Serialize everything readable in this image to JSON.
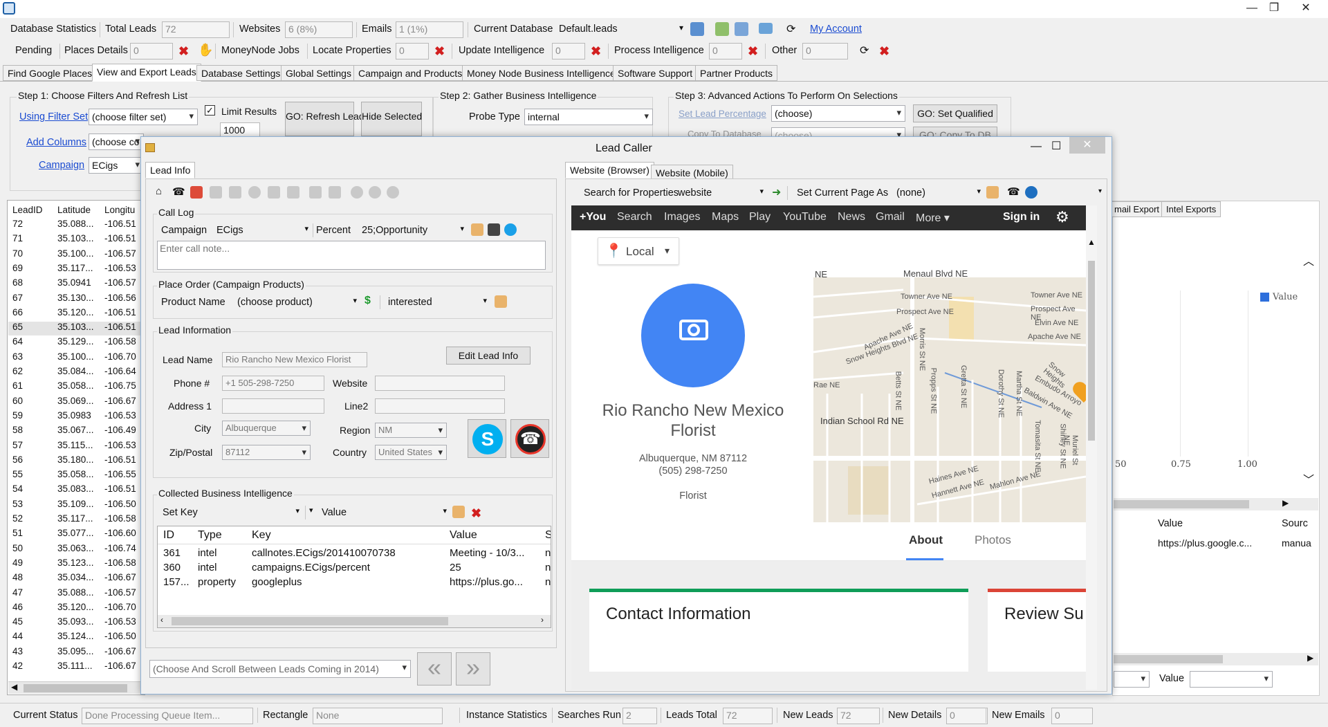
{
  "title_bar": {
    "minimize": "—",
    "maximize": "❐",
    "close": "✕"
  },
  "toolbar1": {
    "db_stats": "Database Statistics",
    "total_leads_label": "Total Leads",
    "total_leads_value": "72",
    "websites_label": "Websites",
    "websites_value": "6 (8%)",
    "emails_label": "Emails",
    "emails_value": "1 (1%)",
    "current_db_label": "Current Database",
    "current_db_value": "Default.leads",
    "my_account": "My Account"
  },
  "toolbar2": {
    "pending": "Pending",
    "places_details_label": "Places Details",
    "places_details_value": "0",
    "moneynode_jobs": "MoneyNode Jobs",
    "locate_properties_label": "Locate Properties",
    "locate_properties_value": "0",
    "update_intel_label": "Update Intelligence",
    "update_intel_value": "0",
    "process_intel_label": "Process Intelligence",
    "process_intel_value": "0",
    "other_label": "Other",
    "other_value": "0"
  },
  "tabs": [
    "Find Google Places",
    "View and Export Leads",
    "Database Settings",
    "Global Settings",
    "Campaign and Products",
    "Money Node Business Intelligence",
    "Software Support",
    "Partner Products"
  ],
  "step1": {
    "title": "Step 1: Choose Filters And Refresh List",
    "using_filter_set": "Using Filter Set",
    "filter_set_value": "(choose filter set)",
    "limit_results": "Limit Results",
    "limit_value": "1000",
    "refresh_btn": "GO: Refresh Leads",
    "hide_btn": "Hide Selected",
    "add_columns": "Add Columns",
    "add_columns_value": "(choose co",
    "campaign": "Campaign",
    "campaign_value": "ECigs"
  },
  "step2": {
    "title": "Step 2: Gather Business Intelligence",
    "probe_label": "Probe Type",
    "probe_value": "internal"
  },
  "step3": {
    "title": "Step 3: Advanced Actions To Perform On Selections",
    "set_lead_pct": "Set Lead Percentage",
    "set_lead_value": "(choose)",
    "go_qualified": "GO: Set Qualified",
    "copy_db": "Copy To Database",
    "copy_db_value": "(choose)",
    "go_copy": "GO: Copy To DB"
  },
  "leads_grid": {
    "headers": [
      "LeadID",
      "Latitude",
      "Longitu"
    ],
    "rows": [
      [
        "72",
        "35.088...",
        "-106.51"
      ],
      [
        "71",
        "35.103...",
        "-106.51"
      ],
      [
        "70",
        "35.100...",
        "-106.57"
      ],
      [
        "69",
        "35.117...",
        "-106.53"
      ],
      [
        "68",
        "35.0941",
        "-106.57"
      ],
      [
        "67",
        "35.130...",
        "-106.56"
      ],
      [
        "66",
        "35.120...",
        "-106.51"
      ],
      [
        "65",
        "35.103...",
        "-106.51"
      ],
      [
        "64",
        "35.129...",
        "-106.58"
      ],
      [
        "63",
        "35.100...",
        "-106.70"
      ],
      [
        "62",
        "35.084...",
        "-106.64"
      ],
      [
        "61",
        "35.058...",
        "-106.75"
      ],
      [
        "60",
        "35.069...",
        "-106.67"
      ],
      [
        "59",
        "35.0983",
        "-106.53"
      ],
      [
        "58",
        "35.067...",
        "-106.49"
      ],
      [
        "57",
        "35.115...",
        "-106.53"
      ],
      [
        "56",
        "35.180...",
        "-106.51"
      ],
      [
        "55",
        "35.058...",
        "-106.55"
      ],
      [
        "54",
        "35.083...",
        "-106.51"
      ],
      [
        "53",
        "35.109...",
        "-106.50"
      ],
      [
        "52",
        "35.117...",
        "-106.58"
      ],
      [
        "51",
        "35.077...",
        "-106.60"
      ],
      [
        "50",
        "35.063...",
        "-106.74"
      ],
      [
        "49",
        "35.123...",
        "-106.58"
      ],
      [
        "48",
        "35.034...",
        "-106.67"
      ],
      [
        "47",
        "35.088...",
        "-106.57"
      ],
      [
        "46",
        "35.120...",
        "-106.70"
      ],
      [
        "45",
        "35.093...",
        "-106.53"
      ],
      [
        "44",
        "35.124...",
        "-106.50"
      ],
      [
        "43",
        "35.095...",
        "-106.67"
      ],
      [
        "42",
        "35.111...",
        "-106.67"
      ]
    ]
  },
  "right_bg": {
    "tabs": [
      "mail Export",
      "Intel Exports"
    ],
    "legend": "Value",
    "ticks": [
      "50",
      "0.75",
      "1.00"
    ],
    "grid_headers": [
      "Value",
      "Sourc"
    ],
    "grid_row": [
      "https://plus.google.c...",
      "manua"
    ],
    "value_label": "Value"
  },
  "dialog": {
    "title": "Lead Caller",
    "left_tab": "Lead Info",
    "call_log": "Call Log",
    "campaign_label": "Campaign",
    "campaign_value": "ECigs",
    "percent_label": "Percent",
    "percent_value": "25;Opportunity",
    "note_placeholder": "Enter call note...",
    "place_order": "Place Order (Campaign Products)",
    "product_label": "Product Name",
    "product_value": "(choose product)",
    "interest_value": "interested",
    "lead_info": "Lead Information",
    "lead_name_label": "Lead Name",
    "lead_name_value": "Rio Rancho New Mexico Florist",
    "edit_btn": "Edit Lead Info",
    "phone_label": "Phone #",
    "phone_value": "+1 505-298-7250",
    "website_label": "Website",
    "address_label": "Address 1",
    "line2_label": "Line2",
    "city_label": "City",
    "city_value": "Albuquerque",
    "region_label": "Region",
    "region_value": "NM",
    "zip_label": "Zip/Postal",
    "zip_value": "87112",
    "country_label": "Country",
    "country_value": "United States",
    "collected": "Collected Business Intelligence",
    "set_key": "Set Key",
    "value_combo": "Value",
    "intel_headers": [
      "ID",
      "Type",
      "Key",
      "Value",
      "S"
    ],
    "intel_rows": [
      [
        "361",
        "intel",
        "callnotes.ECigs/201410070738",
        "Meeting - 10/3...",
        "n"
      ],
      [
        "360",
        "intel",
        "campaigns.ECigs/percent",
        "25",
        "n"
      ],
      [
        "157...",
        "property",
        "googleplus",
        "https://plus.go...",
        "n"
      ]
    ],
    "scroll_leads": "(Choose And Scroll Between Leads Coming in 2014)",
    "prev": "«",
    "next": "»",
    "right_tabs": [
      "Website (Browser)",
      "Website (Mobile)"
    ],
    "search_label": "Search for Properties",
    "search_value": "website",
    "set_page_label": "Set Current Page As",
    "set_page_value": "(none)"
  },
  "google": {
    "nav": [
      "+You",
      "Search",
      "Images",
      "Maps",
      "Play",
      "YouTube",
      "News",
      "Gmail",
      "More"
    ],
    "sign_in": "Sign in",
    "local": "Local",
    "business_name": "Rio Rancho New Mexico Florist",
    "address": "Albuquerque, NM 87112",
    "phone": "(505) 298-7250",
    "category": "Florist",
    "tab_about": "About",
    "tab_photos": "Photos",
    "contact": "Contact Information",
    "review": "Review Su",
    "streets": [
      "Menaul Blvd NE",
      "NE",
      "Towner Ave NE",
      "Towner Ave NE",
      "Prospect Ave NE",
      "Prospect Ave NE",
      "Elvin Ave NE",
      "Apache Ave NE",
      "Apache Ave NE",
      "Snow Heights Blvd NE",
      "Morris St NE",
      "Indian School Rd NE",
      "Haines Ave NE",
      "Hannett Ave NE",
      "Mahlon Ave NE",
      "Dorothy St NE",
      "Martha St NE",
      "Gretta St NE",
      "Betts St NE",
      "Propps St NE",
      "Tomasita St NE",
      "Shirley St NE",
      "Muriel St NE",
      "Baldwin Ave NE",
      "Embudo Arroyo",
      "Snow Heights",
      "Rae NE"
    ]
  },
  "status_bar": {
    "current_status_label": "Current Status",
    "current_status_value": "Done Processing Queue Item...",
    "rectangle_label": "Rectangle",
    "rectangle_value": "None",
    "instance_stats": "Instance Statistics",
    "searches_label": "Searches Run",
    "searches_value": "2",
    "leads_total_label": "Leads Total",
    "leads_total_value": "72",
    "new_leads_label": "New Leads",
    "new_leads_value": "72",
    "new_details_label": "New Details",
    "new_details_value": "0",
    "new_emails_label": "New Emails",
    "new_emails_value": "0"
  },
  "colors": {
    "link": "#1a4bd1",
    "google_blue": "#4285f4",
    "red_x": "#d21f1f",
    "google_bar": "#2d2d2d"
  }
}
